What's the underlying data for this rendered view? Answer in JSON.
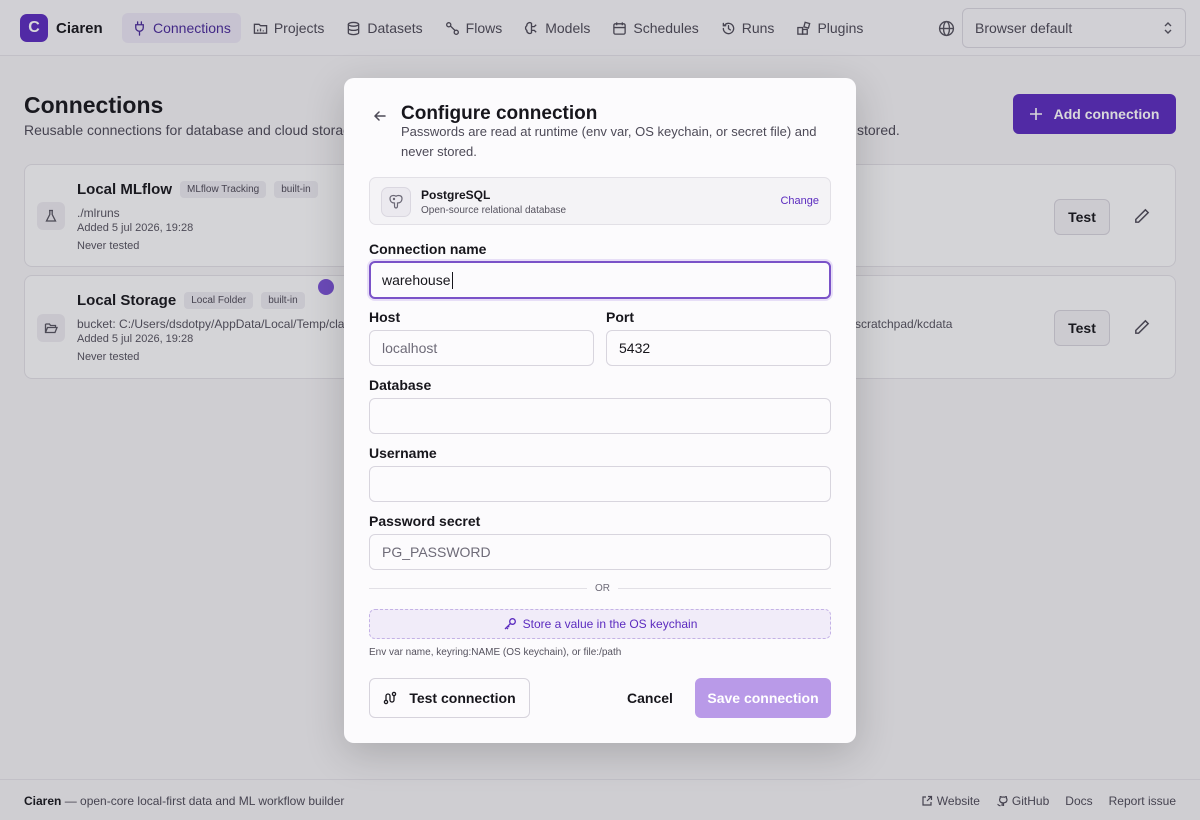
{
  "app": {
    "name": "Ciaren",
    "logo_letter": "C"
  },
  "nav": {
    "items": [
      {
        "label": "Connections",
        "icon": "plug-icon"
      },
      {
        "label": "Projects",
        "icon": "folder-icon"
      },
      {
        "label": "Datasets",
        "icon": "database-icon"
      },
      {
        "label": "Flows",
        "icon": "flow-icon"
      },
      {
        "label": "Models",
        "icon": "brain-icon"
      },
      {
        "label": "Schedules",
        "icon": "calendar-icon"
      },
      {
        "label": "Runs",
        "icon": "history-icon"
      },
      {
        "label": "Plugins",
        "icon": "plugin-icon"
      }
    ],
    "active": "Connections",
    "language_select": "Browser default"
  },
  "page": {
    "title": "Connections",
    "subtitle": "Reusable connections for database and cloud storag",
    "subtitle_tail": "stored.",
    "add_button": "Add connection"
  },
  "connections": [
    {
      "name": "Local MLflow",
      "badges": [
        "MLflow Tracking",
        "built-in"
      ],
      "detail": "./mlruns",
      "added": "Added 5 jul 2026, 19:28",
      "tested": "Never tested",
      "tail": "",
      "test_label": "Test",
      "icon": "flask-icon"
    },
    {
      "name": "Local Storage",
      "badges": [
        "Local Folder",
        "built-in"
      ],
      "detail": "bucket: C:/Users/dsdotpy/AppData/Local/Temp/cla",
      "added": "Added 5 jul 2026, 19:28",
      "tested": "Never tested",
      "tail": "scratchpad/kcdata",
      "test_label": "Test",
      "icon": "folder-open-icon"
    }
  ],
  "modal": {
    "title": "Configure connection",
    "description": "Passwords are read at runtime (env var, OS keychain, or secret file) and never stored.",
    "db": {
      "name": "PostgreSQL",
      "description": "Open-source relational database",
      "change": "Change"
    },
    "fields": {
      "connection_name": {
        "label": "Connection name",
        "value": "warehouse"
      },
      "host": {
        "label": "Host",
        "placeholder": "localhost"
      },
      "port": {
        "label": "Port",
        "value": "5432"
      },
      "database": {
        "label": "Database",
        "value": ""
      },
      "username": {
        "label": "Username",
        "value": ""
      },
      "password_secret": {
        "label": "Password secret",
        "placeholder": "PG_PASSWORD"
      }
    },
    "or_text": "OR",
    "keychain_button": "Store a value in the OS keychain",
    "hint": "Env var name, keyring:NAME (OS keychain), or file:/path",
    "buttons": {
      "test": "Test connection",
      "cancel": "Cancel",
      "save": "Save connection"
    }
  },
  "footer": {
    "brand": "Ciaren",
    "tagline": " — open-core local-first data and ML workflow builder",
    "links": [
      "Website",
      "GitHub",
      "Docs",
      "Report issue"
    ]
  },
  "colors": {
    "accent": "#5b2bbf",
    "accent_disabled": "#b99ae8",
    "focus_ring": "#7a52c8"
  }
}
